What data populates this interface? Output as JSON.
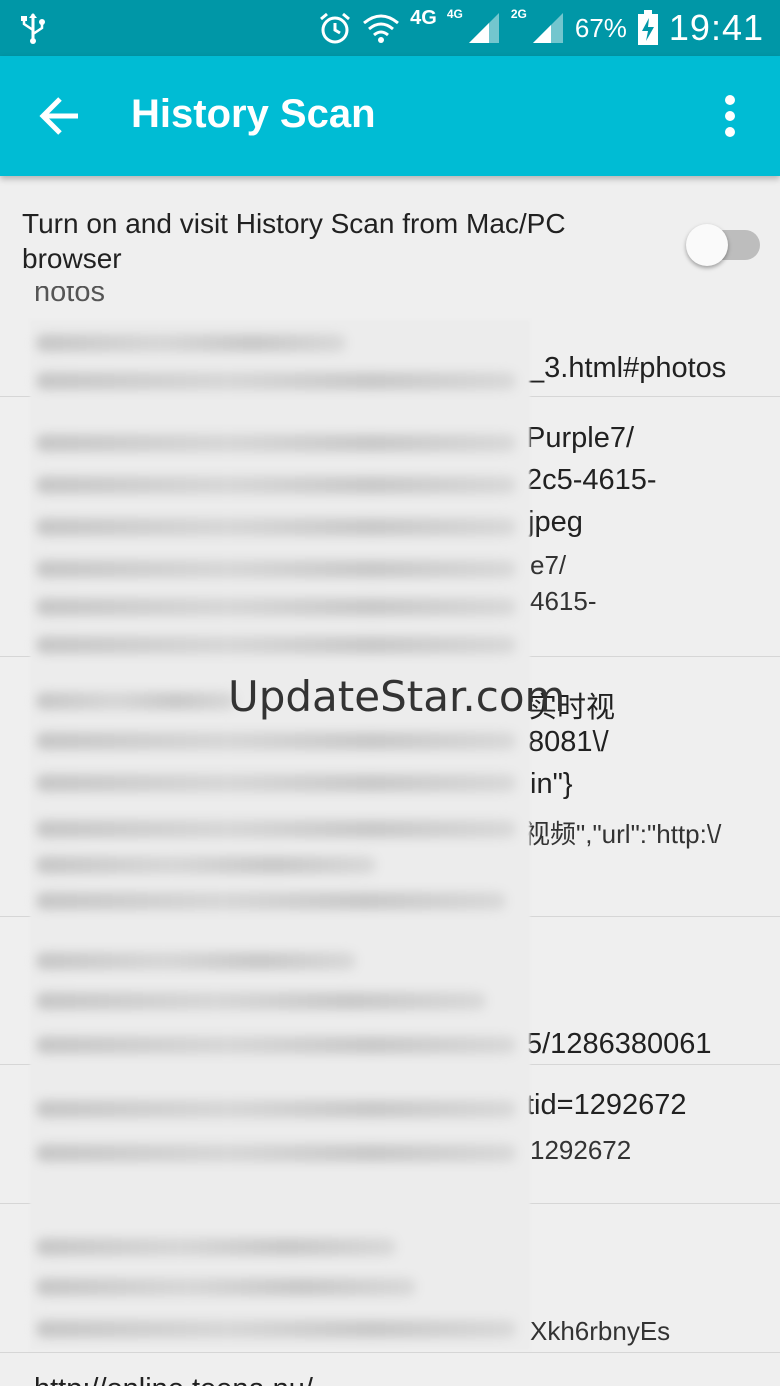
{
  "status_bar": {
    "network_label": "4G",
    "signal1_label": "4G",
    "signal2_label": "2G",
    "battery": "67%",
    "time": "19:41"
  },
  "toolbar": {
    "title": "History Scan"
  },
  "setting": {
    "label": "Turn on and visit History Scan from Mac/PC browser",
    "toggle_on": false
  },
  "list": {
    "items": [
      {
        "lines": [
          "hotos",
          "_3.html#photos"
        ]
      },
      {
        "lines": [
          "Purple7/",
          "2c5-4615-",
          "jpeg",
          "e7/",
          "4615-"
        ]
      },
      {
        "lines": [
          "实时视",
          "8081\\/",
          "in\"}",
          "视频\",\"url\":\"http:\\/"
        ]
      },
      {
        "lines": [
          "5/1286380061"
        ]
      },
      {
        "lines": [
          "tid=1292672",
          "1292672"
        ]
      },
      {
        "lines": [
          "Xkh6rbnyEs"
        ]
      },
      {
        "lines": [
          "http://online.teena.nu/"
        ]
      }
    ]
  },
  "watermark": "UpdateStar.com",
  "colors": {
    "status_bar": "#0097a7",
    "toolbar": "#00bcd4",
    "background": "#efefef"
  }
}
